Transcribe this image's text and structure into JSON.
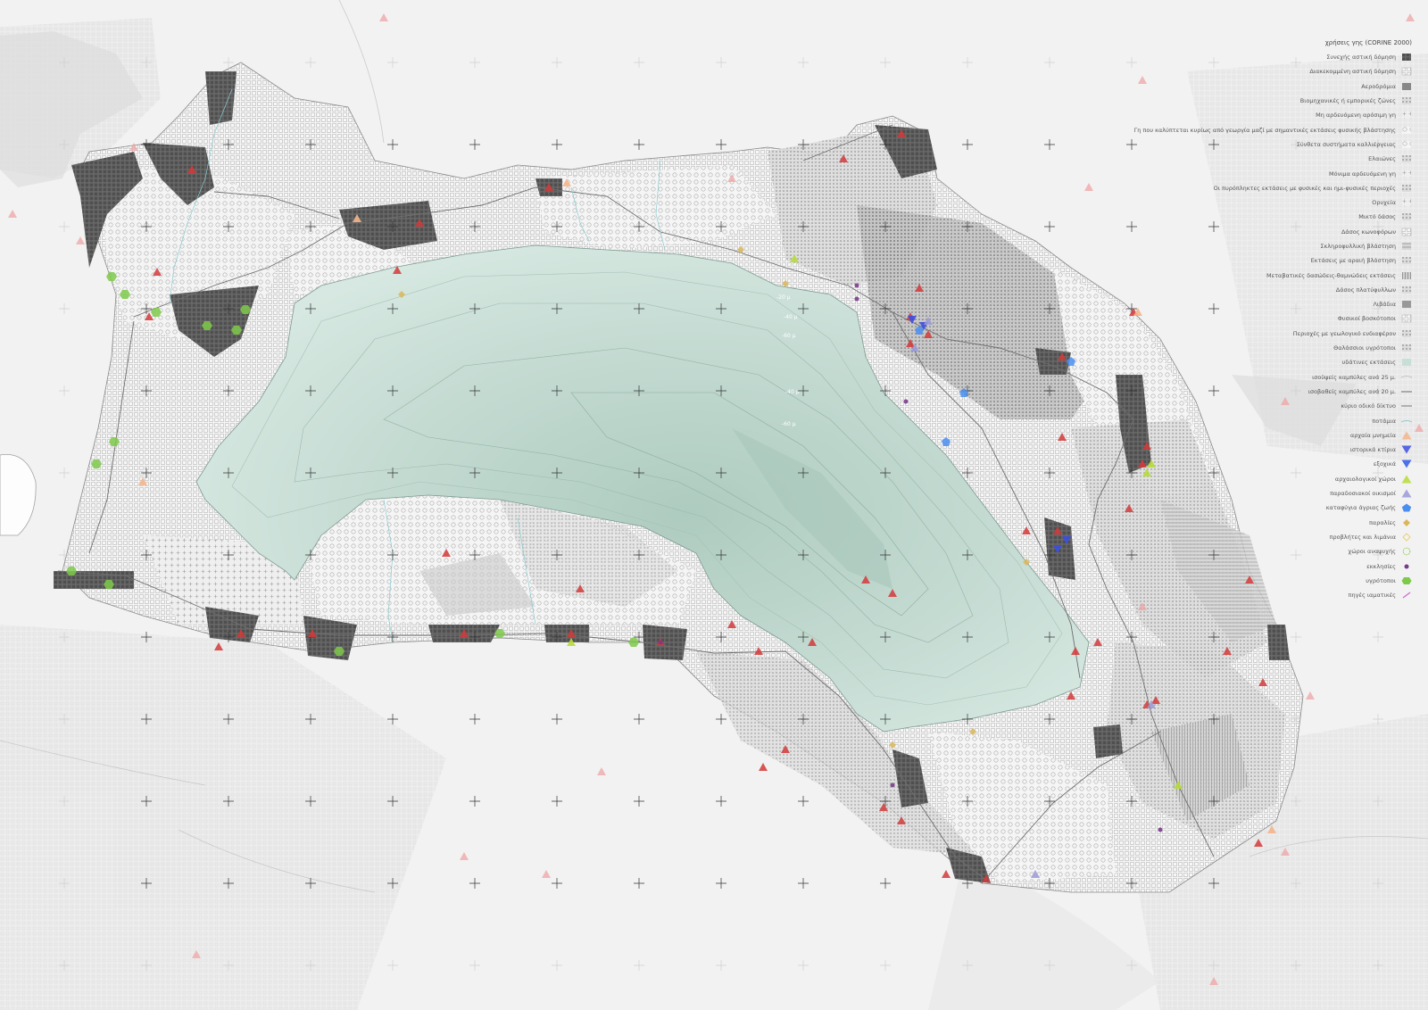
{
  "legend": {
    "title": "χρήσεις γης (CORINE 2000)",
    "items": [
      {
        "label": "Συνεχής αστική δόμηση",
        "swatch": "p-dense",
        "color": "#555555"
      },
      {
        "label": "Διακεκομμένη αστική δόμηση",
        "swatch": "p-grid",
        "color": "#777777"
      },
      {
        "label": "Αεροδρόμια",
        "swatch": "solid",
        "color": "#888888"
      },
      {
        "label": "Βιομηχανικές ή εμπορικές ζώνες",
        "swatch": "p-dots",
        "color": "#999999"
      },
      {
        "label": "Μη αρδευόμενη αρόσιμη γη",
        "swatch": "p-plus",
        "color": "#aaaaaa"
      },
      {
        "label": "Γη που καλύπτεται κυρίως από γεωργία μαζί με σημαντικές εκτάσεις φυσικής βλάστησης",
        "swatch": "p-ring",
        "color": "#bbbbbb"
      },
      {
        "label": "Σύνθετα συστήματα καλλιέργειας",
        "swatch": "p-ring",
        "color": "#999999"
      },
      {
        "label": "Ελαιώνες",
        "swatch": "p-dots",
        "color": "#888888"
      },
      {
        "label": "Μόνιμα αρδευόμενη γη",
        "swatch": "p-plus",
        "color": "#888888"
      },
      {
        "label": "Οι πυρόπληκτες εκτάσεις με φυσικές και ημι-φυσικές περιοχές",
        "swatch": "p-dots",
        "color": "#777777"
      },
      {
        "label": "Ορυχεία",
        "swatch": "p-plus",
        "color": "#777777"
      },
      {
        "label": "Μικτό δάσος",
        "swatch": "p-dots",
        "color": "#aaaaaa"
      },
      {
        "label": "Δάσος κωνοφόρων",
        "swatch": "p-grid",
        "color": "#bbbbbb"
      },
      {
        "label": "Σκληροφυλλική βλάστηση",
        "swatch": "p-lines",
        "color": "#888888"
      },
      {
        "label": "Εκτάσεις με αραιή βλάστηση",
        "swatch": "p-dots",
        "color": "#999999"
      },
      {
        "label": "Μεταβατικές δασώδεις-θαμνώδεις εκτάσεις",
        "swatch": "p-vlines",
        "color": "#777777"
      },
      {
        "label": "Δάσος πλατύφυλλων",
        "swatch": "p-dots",
        "color": "#888888"
      },
      {
        "label": "Λιβάδια",
        "swatch": "solid",
        "color": "#999999"
      },
      {
        "label": "Φυσικοί βοσκότοποι",
        "swatch": "p-grid",
        "color": "#aaaaaa"
      },
      {
        "label": "Περιοχές με γεωλογικό ενδιαφέρον",
        "swatch": "p-dots",
        "color": "#cccccc"
      },
      {
        "label": "Θαλάσσιοι υγρότοποι",
        "swatch": "p-dots",
        "color": "#bbbbbb"
      },
      {
        "label": "υδάτινες εκτάσεις",
        "swatch": "water",
        "color": "#c8dfd6"
      },
      {
        "label": "ισοϋψείς καμπύλες ανά 25 μ.",
        "swatch": "contour",
        "color": "#bbbbbb"
      },
      {
        "label": "ισοβαθείς καμπύλες ανά 20 μ.",
        "swatch": "line",
        "color": "#666666"
      },
      {
        "label": "κύριο οδικό δίκτυο",
        "swatch": "line",
        "color": "#777777"
      },
      {
        "label": "ποτάμια",
        "swatch": "river",
        "color": "#8ccbd0"
      },
      {
        "label": "αρχαία μνημεία",
        "swatch": "tri-up",
        "color": "#f3b58c"
      },
      {
        "label": "ιστορικά κτίρια",
        "swatch": "tri-down",
        "color": "#3d4fe0"
      },
      {
        "label": "εξοχικά",
        "swatch": "tri-down",
        "color": "#2f5ae8"
      },
      {
        "label": "αρχαιολογικοί χώροι",
        "swatch": "tri-up",
        "color": "#b6dc3a"
      },
      {
        "label": "παραδοσιακοί οικισμοί",
        "swatch": "tri-up",
        "color": "#9a9ad8"
      },
      {
        "label": "καταφύγια άγριας ζωής",
        "swatch": "pentagon",
        "color": "#4a8ef0"
      },
      {
        "label": "παραλίες",
        "swatch": "diamond",
        "color": "#d9b65a"
      },
      {
        "label": "προβλήτες και λιμάνια",
        "swatch": "diamond-o",
        "color": "#e8d07a"
      },
      {
        "label": "χώροι αναψυχής",
        "swatch": "circle-o",
        "color": "#8ed04c"
      },
      {
        "label": "εκκλησίες",
        "swatch": "dot",
        "color": "#7a3a8a"
      },
      {
        "label": "υγρότοποι",
        "swatch": "hexagon",
        "color": "#7ec94a"
      },
      {
        "label": "πηγές ιαματικές",
        "swatch": "pin",
        "color": "#d46ad4"
      }
    ]
  },
  "lake_labels": [
    "-20 μ",
    "-40 μ",
    "-60 μ",
    "-40 μ",
    "-60 μ"
  ],
  "colors": {
    "background": "#f2f2f2",
    "lake": "#cfe3dc",
    "lake_deep": "#b7d2c8",
    "urban": "#5f5f5f",
    "red_marker": "#d23a3a",
    "green_marker": "#7ec94a"
  }
}
